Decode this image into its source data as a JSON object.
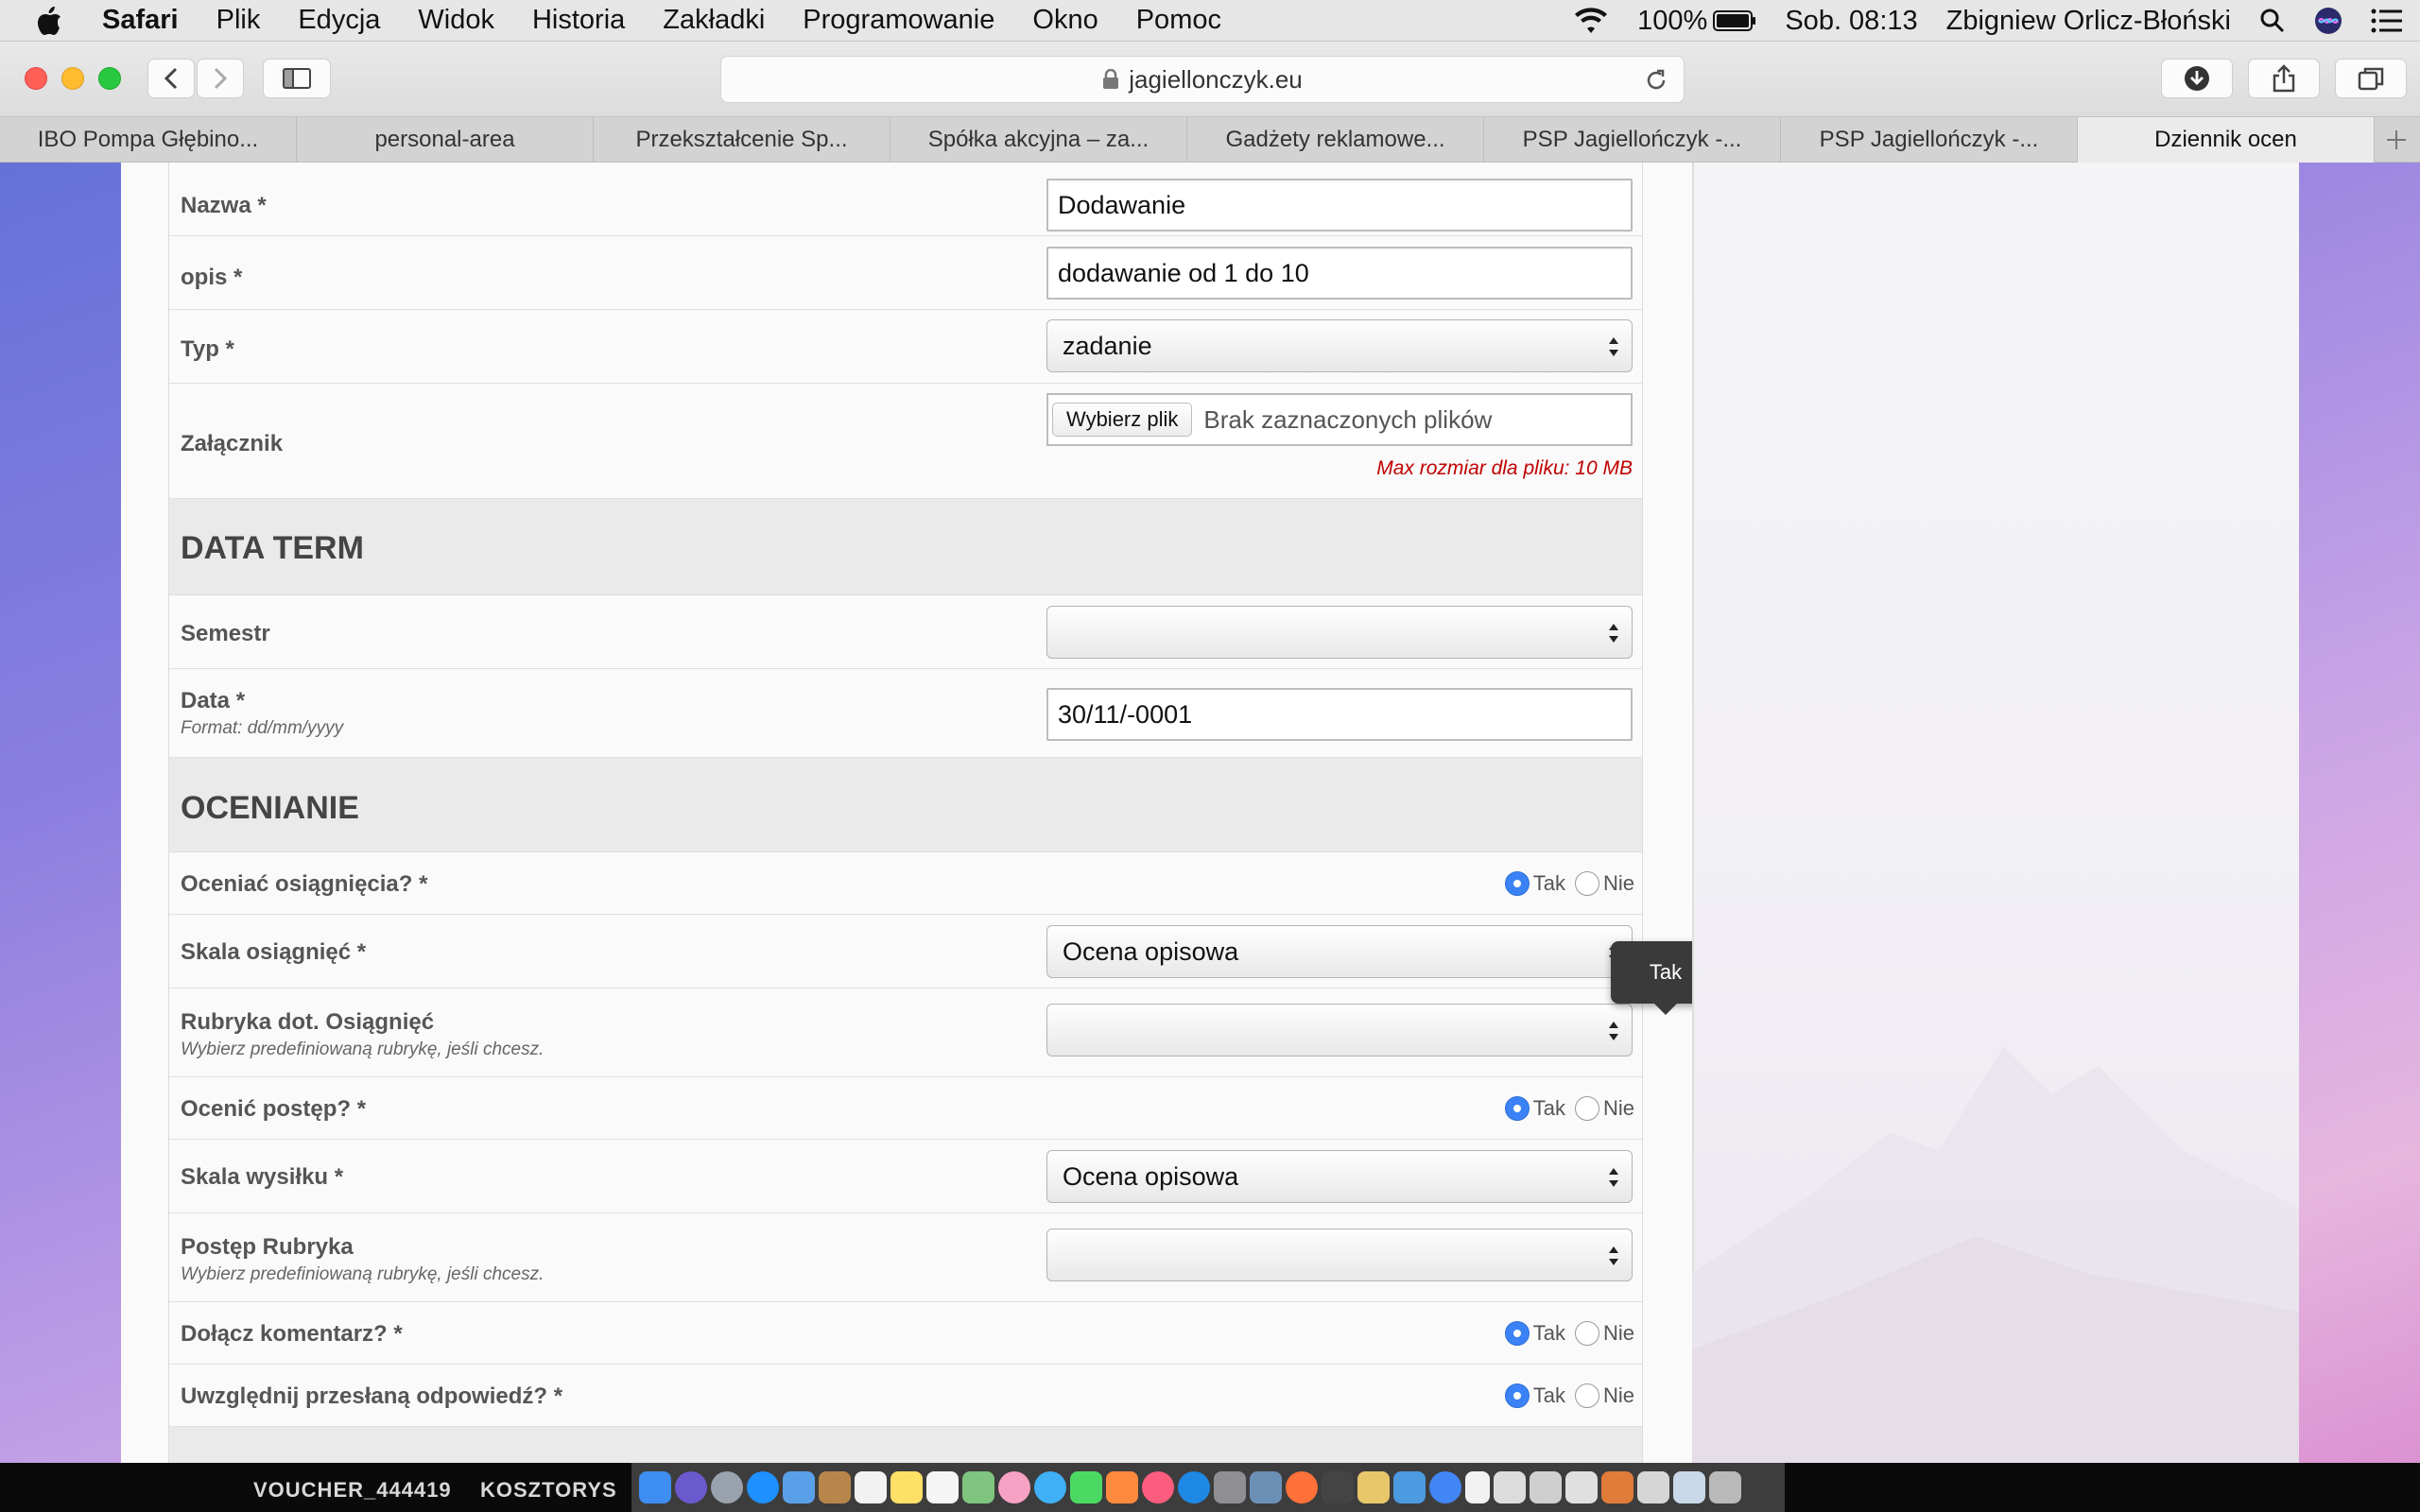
{
  "menubar": {
    "app_name": "Safari",
    "items": [
      "Plik",
      "Edycja",
      "Widok",
      "Historia",
      "Zakładki",
      "Programowanie",
      "Okno",
      "Pomoc"
    ],
    "battery": "100%",
    "clock": "Sob. 08:13",
    "user": "Zbigniew Orlicz-Błoński"
  },
  "browser": {
    "url": "jagiellonczyk.eu",
    "tabs": [
      {
        "label": "IBO Pompa Głębino..."
      },
      {
        "label": "personal-area"
      },
      {
        "label": "Przekształcenie Sp..."
      },
      {
        "label": "Spółka akcyjna – za..."
      },
      {
        "label": "Gadżety reklamowe..."
      },
      {
        "label": "PSP Jagiellończyk -..."
      },
      {
        "label": "PSP Jagiellończyk -..."
      },
      {
        "label": "Dziennik ocen"
      }
    ],
    "active_tab": "Dziennik ocen"
  },
  "form": {
    "nazwa": {
      "label": "Nazwa *",
      "value": "Dodawanie"
    },
    "opis": {
      "label": "opis *",
      "value": "dodawanie od 1 do 10"
    },
    "typ": {
      "label": "Typ *",
      "value": "zadanie"
    },
    "zalacznik": {
      "label": "Załącznik",
      "button": "Wybierz plik",
      "status": "Brak zaznaczonych plików",
      "note": "Max rozmiar dla pliku: 10 MB"
    },
    "section_data_term": "DATA TERM",
    "semestr": {
      "label": "Semestr",
      "value": ""
    },
    "data": {
      "label": "Data *",
      "hint": "Format: dd/mm/yyyy",
      "value": "30/11/-0001"
    },
    "section_ocenianie": "OCENIANIE",
    "tooltip": "Tak",
    "oceniac_osiagniecia": {
      "label": "Oceniać osiągnięcia? *",
      "yes": "Tak",
      "no": "Nie",
      "selected": "Tak"
    },
    "skala_osiagniec": {
      "label": "Skala osiągnięć *",
      "value": "Ocena opisowa"
    },
    "rubryka_osiagniec": {
      "label": "Rubryka dot. Osiągnięć",
      "hint": "Wybierz predefiniowaną rubrykę, jeśli chcesz.",
      "value": ""
    },
    "ocenic_postep": {
      "label": "Ocenić postęp? *",
      "yes": "Tak",
      "no": "Nie",
      "selected": "Tak"
    },
    "skala_wysilku": {
      "label": "Skala wysiłku *",
      "value": "Ocena opisowa"
    },
    "postep_rubryka": {
      "label": "Postęp Rubryka",
      "hint": "Wybierz predefiniowaną rubrykę, jeśli chcesz.",
      "value": ""
    },
    "dolacz_komentarz": {
      "label": "Dołącz komentarz? *",
      "yes": "Tak",
      "no": "Nie",
      "selected": "Tak"
    },
    "uwzglednij_odpowiedz": {
      "label": "Uwzględnij przesłaną odpowiedź? *",
      "yes": "Tak",
      "no": "Nie",
      "selected": "Tak"
    }
  },
  "desktop": {
    "labels": [
      "VOUCHER_444419",
      "KOSZTORYS"
    ]
  }
}
